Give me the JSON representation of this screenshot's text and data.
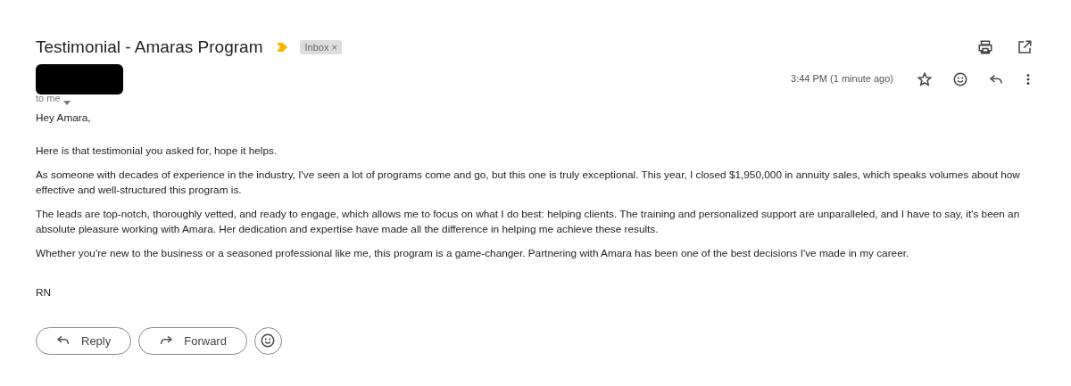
{
  "subject": "Testimonial - Amaras Program",
  "label": {
    "text": "Inbox",
    "close": "×"
  },
  "recipient": "to me",
  "time": "3:44 PM (1 minute ago)",
  "paragraphs": [
    "Hey Amara,",
    "Here is that testimonial you asked for, hope it helps.",
    "As someone with decades of experience in the industry, I've seen a lot of programs come and go, but this one is truly exceptional. This year, I closed $1,950,000 in annuity sales, which speaks volumes about how effective and well-structured this program is.",
    "The leads are top-notch, thoroughly vetted, and ready to engage, which allows me to focus on what I do best: helping clients. The training and personalized support are unparalleled, and I have to say, it's been an absolute pleasure working with Amara. Her dedication and expertise have made all the difference in helping me achieve these results.",
    "Whether you're new to the business or a seasoned professional like me, this program is a game-changer. Partnering with Amara has been one of the best decisions I've made in my career."
  ],
  "signature": "RN",
  "buttons": [
    "Reply",
    "Forward"
  ]
}
